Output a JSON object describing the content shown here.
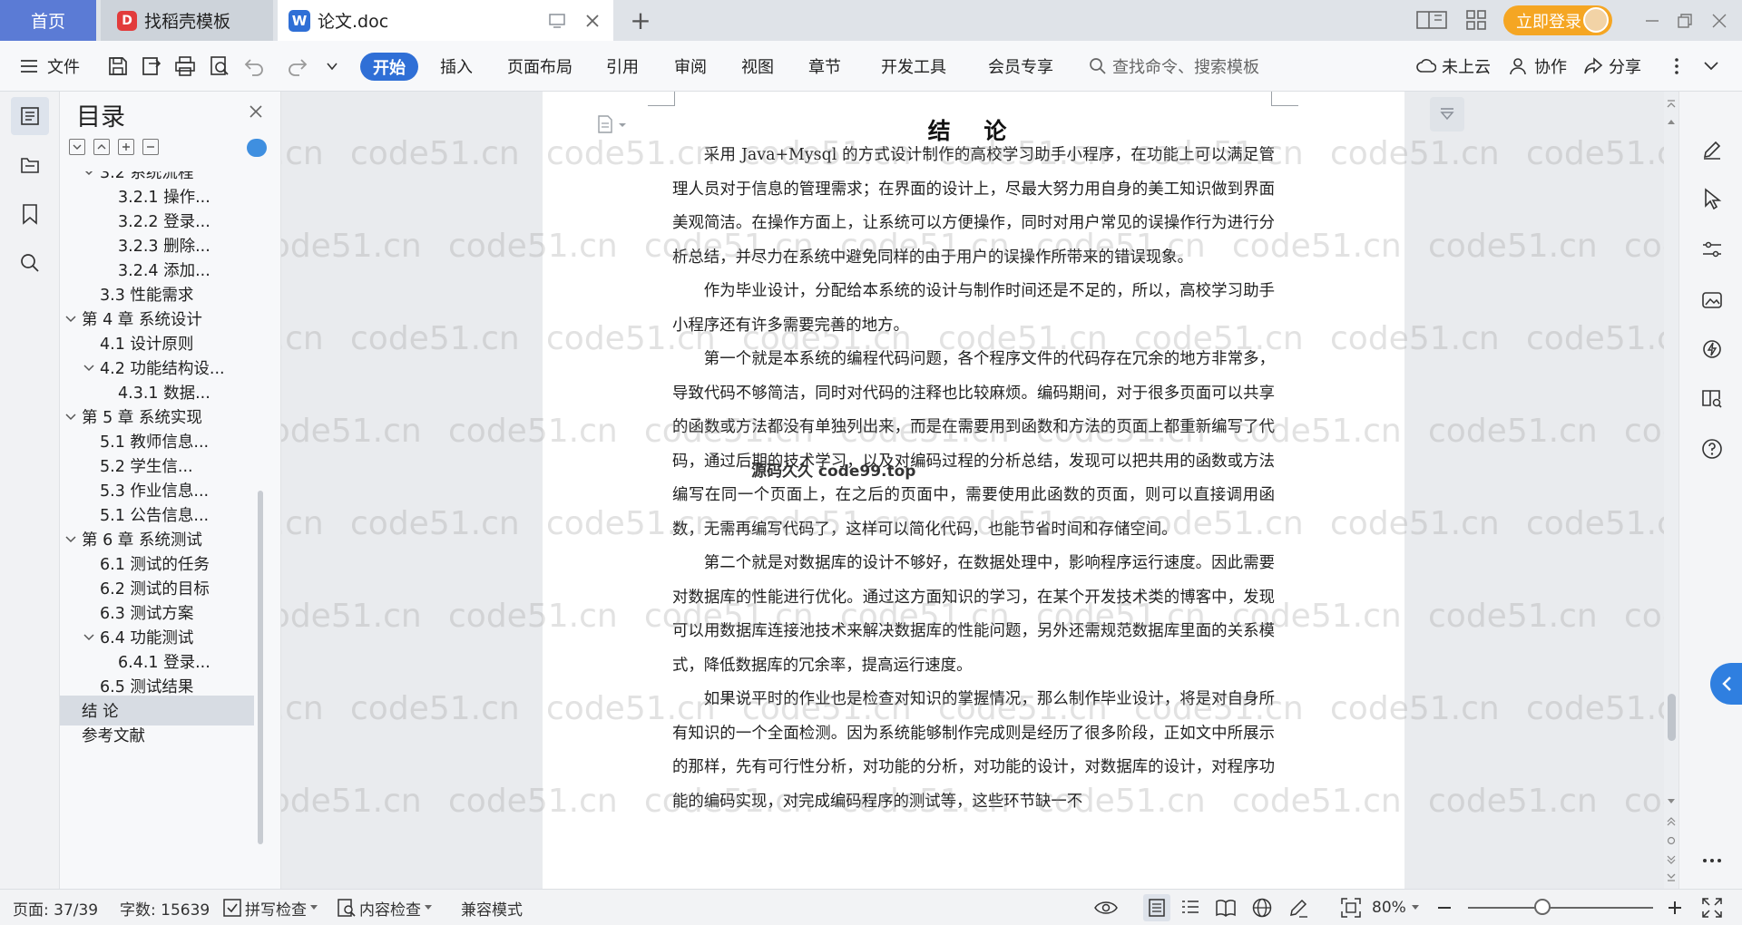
{
  "titlebar": {
    "tabs": [
      {
        "label": "首页",
        "icon": "home"
      },
      {
        "label": "找稻壳模板",
        "icon": "docer-logo"
      },
      {
        "label": "论文.doc",
        "icon": "wps-writer-logo"
      }
    ],
    "new_tab": "+",
    "login_label": "立即登录"
  },
  "ribbon": {
    "file_label": "文件",
    "tabs": [
      "开始",
      "插入",
      "页面布局",
      "引用",
      "审阅",
      "视图",
      "章节",
      "开发工具",
      "会员专享"
    ],
    "active_tab": "开始",
    "search_placeholder": "查找命令、搜索模板",
    "cloud_label": "未上云",
    "collab_label": "协作",
    "share_label": "分享"
  },
  "toc": {
    "title": "目录",
    "items": [
      {
        "label": "3.2 系统流程",
        "level": 2,
        "caret": "v"
      },
      {
        "label": "3.2.1 操作...",
        "level": 3
      },
      {
        "label": "3.2.2 登录...",
        "level": 3
      },
      {
        "label": "3.2.3 删除...",
        "level": 3
      },
      {
        "label": "3.2.4 添加...",
        "level": 3
      },
      {
        "label": "3.3 性能需求",
        "level": 2
      },
      {
        "label": "第 4 章 系统设计",
        "level": 1,
        "caret": "v"
      },
      {
        "label": "4.1 设计原则",
        "level": 2
      },
      {
        "label": "4.2 功能结构设...",
        "level": 2,
        "caret": "v"
      },
      {
        "label": "4.3.1 数据...",
        "level": 3
      },
      {
        "label": "第 5 章 系统实现",
        "level": 1,
        "caret": "v"
      },
      {
        "label": "5.1 教师信息...",
        "level": 2
      },
      {
        "label": "5.2 学生信...",
        "level": 2
      },
      {
        "label": "5.3 作业信息...",
        "level": 2
      },
      {
        "label": "5.1 公告信息...",
        "level": 2
      },
      {
        "label": "第 6 章 系统测试",
        "level": 1,
        "caret": "v"
      },
      {
        "label": "6.1 测试的任务",
        "level": 2
      },
      {
        "label": "6.2 测试的目标",
        "level": 2
      },
      {
        "label": "6.3 测试方案",
        "level": 2
      },
      {
        "label": "6.4 功能测试",
        "level": 2,
        "caret": "v"
      },
      {
        "label": "6.4.1 登录...",
        "level": 3
      },
      {
        "label": "6.5 测试结果",
        "level": 2
      },
      {
        "label": "结  论",
        "level": 1,
        "selected": true
      },
      {
        "label": "参考文献",
        "level": 1
      }
    ]
  },
  "document": {
    "heading": "结 论",
    "paragraphs": [
      "采用 Java+Mysql 的方式设计制作的高校学习助手小程序，在功能上可以满足管理人员对于信息的管理需求；在界面的设计上，尽最大努力用自身的美工知识做到界面美观简洁。在操作方面上，让系统可以方便操作，同时对用户常见的误操作行为进行分析总结，并尽力在系统中避免同样的由于用户的误操作所带来的错误现象。",
      "作为毕业设计，分配给本系统的设计与制作时间还是不足的，所以，高校学习助手小程序还有许多需要完善的地方。",
      "第一个就是本系统的编程代码问题，各个程序文件的代码存在冗余的地方非常多，导致代码不够简洁，同时对代码的注释也比较麻烦。编码期间，对于很多页面可以共享的函数或方法都没有单独列出来，而是在需要用到函数和方法的页面上都重新编写了代码，通过后期的技术学习，以及对编码过程的分析总结，发现可以把共用的函数或方法编写在同一个页面上，在之后的页面中，需要使用此函数的页面，则可以直接调用函数，无需再编写代码了，这样可以简化代码，也能节省时间和存储空间。",
      "第二个就是对数据库的设计不够好，在数据处理中，影响程序运行速度。因此需要对数据库的性能进行优化。通过这方面知识的学习，在某个开发技术类的博客中，发现可以用数据库连接池技术来解决数据库的性能问题，另外还需规范数据库里面的关系模式，降低数据库的冗余率，提高运行速度。",
      "如果说平时的作业也是检查对知识的掌握情况，那么制作毕业设计，将是对自身所有知识的一个全面检测。因为系统能够制作完成则是经历了很多阶段，正如文中所展示的那样，先有可行性分析，对功能的分析，对功能的设计，对数据库的设计，对程序功能的编码实现，对完成编码程序的测试等，这些环节缺一不"
    ],
    "overlay_stamp": "源码久久 code99.top",
    "watermark": "code51.cn"
  },
  "statusbar": {
    "page": "页面: 37/39",
    "words": "字数: 15639",
    "spell_check": "拼写检查",
    "content_check": "内容检查",
    "compat_mode": "兼容模式",
    "zoom": "80%",
    "zoom_level": 0.4
  }
}
